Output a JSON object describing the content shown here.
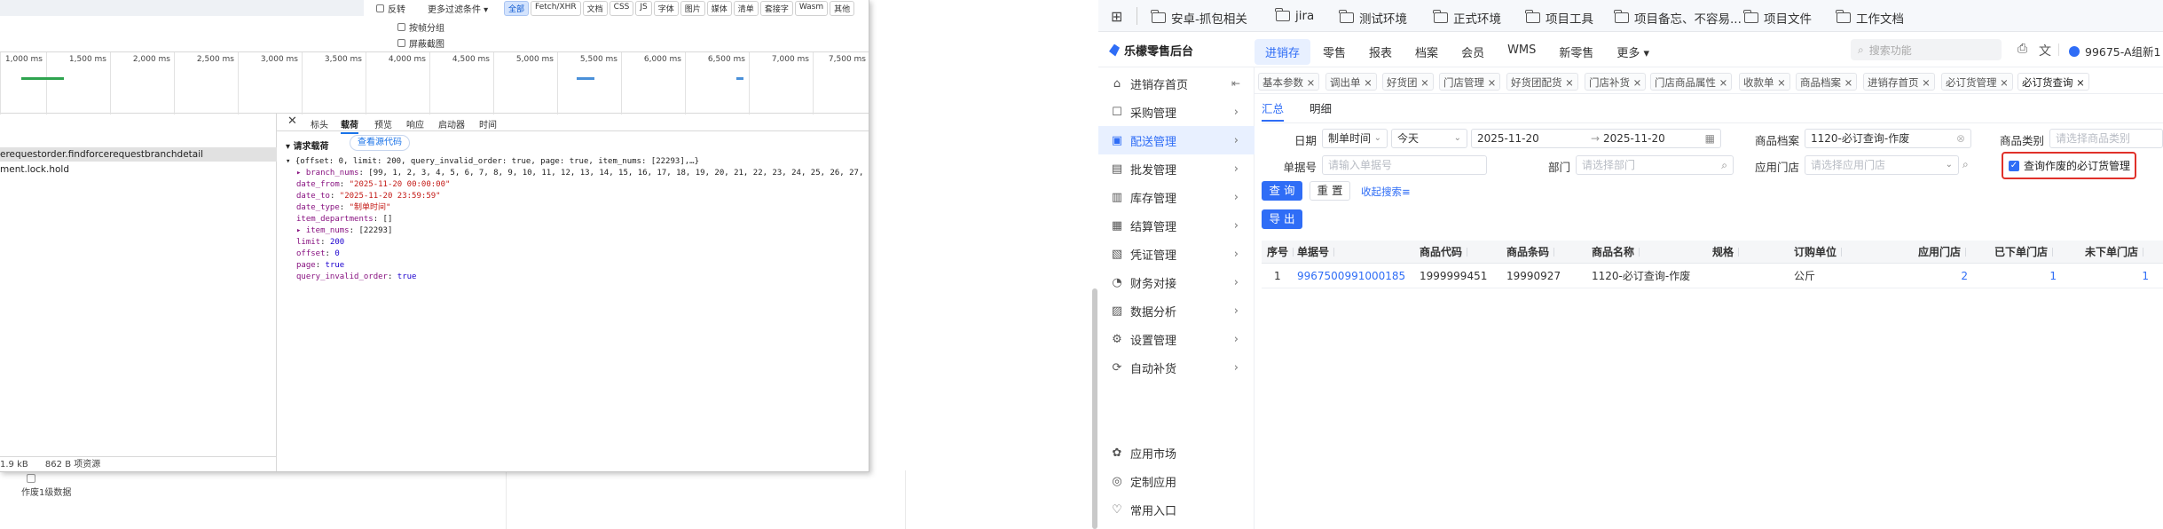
{
  "devtools": {
    "filter": {
      "invert_label": "反转",
      "more_filters_label": "更多过滤条件 ▾",
      "request_types": [
        "全部",
        "Fetch/XHR",
        "文档",
        "CSS",
        "JS",
        "字体",
        "图片",
        "媒体",
        "清单",
        "套接字",
        "Wasm",
        "其他"
      ],
      "active_type": "全部",
      "blocked_requests_label": "按帧分组",
      "hide_extension_label": "屏蔽截图"
    },
    "timeline_ticks": [
      "1,000 ms",
      "1,500 ms",
      "2,000 ms",
      "2,500 ms",
      "3,000 ms",
      "3,500 ms",
      "4,000 ms",
      "4,500 ms",
      "5,000 ms",
      "5,500 ms",
      "6,000 ms",
      "6,500 ms",
      "7,000 ms",
      "7,500 ms"
    ],
    "requests": [
      {
        "name": "erequestorder.findforcerequestbranchdetail",
        "selected": true
      },
      {
        "name": "ment.lock.hold",
        "selected": false
      }
    ],
    "footer": {
      "size": "1.9 kB",
      "resources": "862 B 项资源"
    },
    "detail": {
      "tabs": [
        "标头",
        "载荷",
        "预览",
        "响应",
        "启动器",
        "时间"
      ],
      "active_tab": "载荷",
      "section_title": "▾ 请求载荷",
      "view_source": "查看源代码",
      "lines": [
        {
          "indent": 0,
          "text": "▾ {offset: 0, limit: 200, query_invalid_order: true, page: true, item_nums: [22293],…}"
        },
        {
          "indent": 1,
          "key": "▸ branch_nums",
          "value": "[99, 1, 2, 3, 4, 5, 6, 7, 8, 9, 10, 11, 12, 13, 14, 15, 16, 17, 18, 19, 20, 21, 22, 23, 24, 25, 26, 27,…]",
          "kind": "p"
        },
        {
          "indent": 1,
          "key": "date_from",
          "value": "\"2025-11-20 00:00:00\"",
          "kind": "s"
        },
        {
          "indent": 1,
          "key": "date_to",
          "value": "\"2025-11-20 23:59:59\"",
          "kind": "s"
        },
        {
          "indent": 1,
          "key": "date_type",
          "value": "\"制单时间\"",
          "kind": "s"
        },
        {
          "indent": 1,
          "key": "item_departments",
          "value": "[]",
          "kind": "p"
        },
        {
          "indent": 1,
          "key": "▸ item_nums",
          "value": "[22293]",
          "kind": "p"
        },
        {
          "indent": 1,
          "key": "limit",
          "value": "200",
          "kind": "n"
        },
        {
          "indent": 1,
          "key": "offset",
          "value": "0",
          "kind": "n"
        },
        {
          "indent": 1,
          "key": "page",
          "value": "true",
          "kind": "n"
        },
        {
          "indent": 1,
          "key": "query_invalid_order",
          "value": "true",
          "kind": "n"
        }
      ]
    },
    "under_label": "作废1级数据"
  },
  "browser": {
    "bookmarks": [
      "安卓-抓包相关",
      "jira",
      "测试环境",
      "正式环境",
      "项目工具",
      "项目备忘、不容易...",
      "项目文件",
      "工作文档"
    ]
  },
  "app": {
    "logo_text": "乐檬零售后台",
    "topnav": [
      "进销存",
      "零售",
      "报表",
      "档案",
      "会员",
      "WMS",
      "新零售",
      "更多 ▾"
    ],
    "active_nav": "进销存",
    "search_placeholder": "搜索功能",
    "user_text": "99675-A组新1",
    "sidebar": [
      {
        "label": "进销存首页",
        "icon": "⌂",
        "name": "home",
        "arrow": "⇤"
      },
      {
        "label": "采购管理",
        "icon": "☐",
        "name": "purchase",
        "arrow": "›"
      },
      {
        "label": "配送管理",
        "icon": "▣",
        "name": "distribution",
        "arrow": "›",
        "active": true
      },
      {
        "label": "批发管理",
        "icon": "▤",
        "name": "wholesale",
        "arrow": "›"
      },
      {
        "label": "库存管理",
        "icon": "▥",
        "name": "inventory",
        "arrow": "›"
      },
      {
        "label": "结算管理",
        "icon": "▦",
        "name": "settlement",
        "arrow": "›"
      },
      {
        "label": "凭证管理",
        "icon": "▧",
        "name": "voucher",
        "arrow": "›"
      },
      {
        "label": "财务对接",
        "icon": "◔",
        "name": "finance",
        "arrow": "›"
      },
      {
        "label": "数据分析",
        "icon": "▨",
        "name": "analytics",
        "arrow": "›"
      },
      {
        "label": "设置管理",
        "icon": "⚙",
        "name": "settings",
        "arrow": "›"
      },
      {
        "label": "自动补货",
        "icon": "⟳",
        "name": "auto-replenish",
        "arrow": "›"
      }
    ],
    "sidebar_bottom": [
      {
        "label": "应用市场",
        "icon": "✿",
        "name": "app-market"
      },
      {
        "label": "定制应用",
        "icon": "◎",
        "name": "custom-app"
      },
      {
        "label": "常用入口",
        "icon": "♡",
        "name": "common-entry"
      }
    ],
    "tabs": [
      "基本参数 ×",
      "调出单 ×",
      "好货团 ×",
      "门店管理 ×",
      "好货团配货 ×",
      "门店补货 ×",
      "门店商品属性 ×",
      "收款单 ×",
      "商品档案 ×",
      "进销存首页 ×",
      "必订货管理 ×",
      "必订货查询 ×"
    ],
    "active_tab": "必订货查询 ×",
    "subtabs": [
      "汇总",
      "明细"
    ],
    "active_subtab": "汇总",
    "filters": {
      "date_label": "日期",
      "date_type": "制单时间",
      "date_range": "今天",
      "date_from": "2025-11-20",
      "date_to": "2025-11-20",
      "product_label": "商品档案",
      "product_value": "1120-必订查询-作废",
      "category_label": "商品类别",
      "category_placeholder": "请选择商品类别",
      "order_no_label": "单据号",
      "order_no_placeholder": "请输入单据号",
      "dept_label": "部门",
      "dept_placeholder": "请选择部门",
      "store_label": "应用门店",
      "store_placeholder": "请选择应用门店",
      "invalid_checkbox_label": "查询作废的必订货管理",
      "query_button": "查 询",
      "reset_button": "重 置",
      "collapse_link": "收起搜索≡",
      "export_button": "导 出"
    },
    "table": {
      "headers": [
        "序号",
        "单据号",
        "商品代码",
        "商品条码",
        "商品名称",
        "规格",
        "订购单位",
        "应用门店",
        "已下单门店",
        "未下单门店"
      ],
      "rows": [
        [
          "1",
          "9967500991000185",
          "1999999451",
          "19990927",
          "1120-必订查询-作废",
          "",
          "公斤",
          "2",
          "1",
          "1"
        ]
      ]
    }
  }
}
